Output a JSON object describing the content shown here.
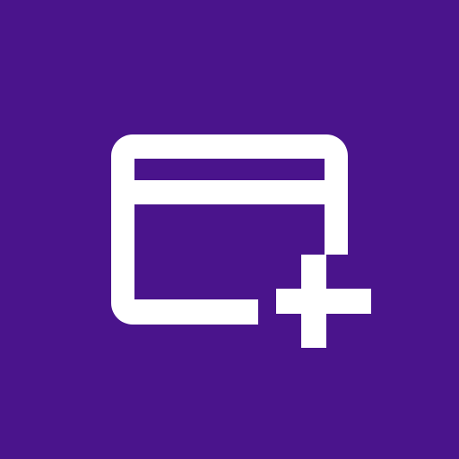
{
  "app_icon": {
    "icon": "add-card-icon",
    "background_color": "#4a148c",
    "glyph_color": "#ffffff"
  }
}
